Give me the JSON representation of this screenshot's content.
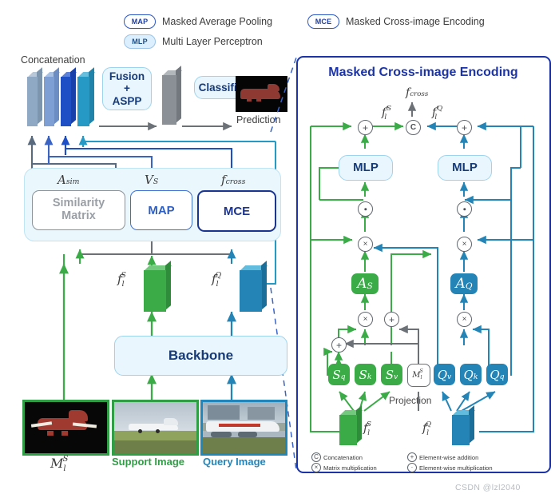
{
  "legend": {
    "items": [
      {
        "tag": "MAP",
        "text": "Masked Average Pooling",
        "style": "outline"
      },
      {
        "tag": "MLP",
        "text": "Multi Layer Perceptron",
        "style": "fill"
      },
      {
        "tag": "MCE",
        "text": "Masked Cross-image Encoding",
        "style": "outline"
      }
    ]
  },
  "pipeline": {
    "concatenation_label": "Concatenation",
    "fusion_label": "Fusion\n+\nASPP",
    "classifier_label": "Classifier",
    "prediction_label": "Prediction",
    "backbone_label": "Backbone"
  },
  "modules": {
    "similarity_matrix_label": "Similarity Matrix",
    "map_label": "MAP",
    "mce_label": "MCE",
    "sym_asim": "A",
    "sym_asim_sub": "sim",
    "sym_vs": "V",
    "sym_vs_sub": "S",
    "sym_fcross": "f",
    "sym_fcross_sub": "cross"
  },
  "features": {
    "support_feat": "f",
    "support_feat_sub": "l",
    "support_feat_sup": "S",
    "query_feat": "f",
    "query_feat_sub": "l",
    "query_feat_sup": "Q",
    "mask_label": "M",
    "mask_sub": "l",
    "mask_sup": "S"
  },
  "inputs": {
    "mask_caption_sym": "M",
    "support_caption": "Support Image",
    "query_caption": "Query Image"
  },
  "mce": {
    "title": "Masked Cross-image Encoding",
    "f_cross": "f",
    "f_cross_sub": "cross",
    "f_prime_s": "f",
    "f_prime_s_sub": "l",
    "f_prime_s_sup": "S",
    "f_prime_q": "f",
    "f_prime_q_sub": "l",
    "f_prime_q_sup": "Q",
    "mlp_label": "MLP",
    "attn_s": "A",
    "attn_s_sub": "S",
    "attn_q": "A",
    "attn_q_sub": "Q",
    "projection_label": "Projection",
    "projections": [
      {
        "base": "S",
        "sub": "q",
        "color": "green"
      },
      {
        "base": "S",
        "sub": "k",
        "color": "green"
      },
      {
        "base": "S",
        "sub": "v",
        "color": "green"
      },
      {
        "base": "M",
        "sub": "l",
        "sup": "S",
        "color": "white"
      },
      {
        "base": "Q",
        "sub": "v",
        "color": "blue"
      },
      {
        "base": "Q",
        "sub": "k",
        "color": "blue"
      },
      {
        "base": "Q",
        "sub": "q",
        "color": "blue"
      }
    ],
    "symbol_legend": [
      {
        "glyph": "C",
        "text": "Concatenation"
      },
      {
        "glyph": "+",
        "text": "Element-wise addition"
      },
      {
        "glyph": "×",
        "text": "Matrix multiplication"
      },
      {
        "glyph": "·",
        "text": "Element-wise multiplication"
      }
    ]
  },
  "watermark": "CSDN @lzl2040",
  "colors": {
    "support_green": "#3bab48",
    "query_blue": "#2484b6",
    "panel_border": "#1b34a8",
    "arrow_grey": "#6b7177",
    "slab1": "#8fa9c4",
    "slab2": "#7e9fd4",
    "slab3": "#1f4fc4",
    "slab4": "#2699c4"
  }
}
